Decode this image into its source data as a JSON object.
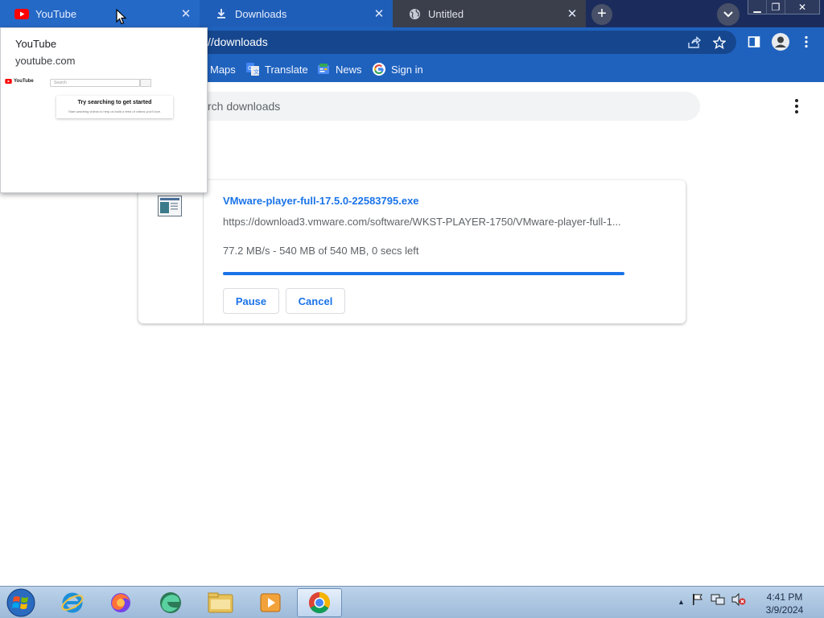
{
  "tabs": [
    {
      "title": "YouTube",
      "icon": "youtube-icon"
    },
    {
      "title": "Downloads",
      "icon": "download-icon"
    },
    {
      "title": "Untitled",
      "icon": "globe-icon"
    }
  ],
  "address_bar": {
    "url": "//downloads"
  },
  "bookmarks": [
    {
      "label": "Maps",
      "icon": "maps-icon"
    },
    {
      "label": "Translate",
      "icon": "translate-icon"
    },
    {
      "label": "News",
      "icon": "news-icon"
    },
    {
      "label": "Sign in",
      "icon": "google-icon"
    }
  ],
  "downloads_page": {
    "search_placeholder": "rch downloads",
    "item": {
      "file_name": "VMware-player-full-17.5.0-22583795.exe",
      "url": "https://download3.vmware.com/software/WKST-PLAYER-1750/VMware-player-full-1...",
      "status": "77.2 MB/s - 540 MB of 540 MB, 0 secs left",
      "progress": 1.0,
      "pause_label": "Pause",
      "cancel_label": "Cancel"
    }
  },
  "hover_card": {
    "title": "YouTube",
    "domain": "youtube.com",
    "thumb_logo": "YouTube",
    "thumb_search_placeholder": "Search",
    "thumb_heading": "Try searching to get started",
    "thumb_subtext": "Start watching videos to help us build a feed of videos you'll love."
  },
  "taskbar": {
    "apps": [
      "internet-explorer-icon",
      "firefox-icon",
      "edge-beta-icon",
      "file-explorer-icon",
      "media-player-icon",
      "chrome-icon"
    ],
    "time": "4:41 PM",
    "date": "3/9/2024"
  },
  "colors": {
    "tabstrip": "#1b2c5c",
    "active_tab": "#2569c7",
    "toolbar": "#1f62be",
    "link_blue": "#1a73e8"
  }
}
